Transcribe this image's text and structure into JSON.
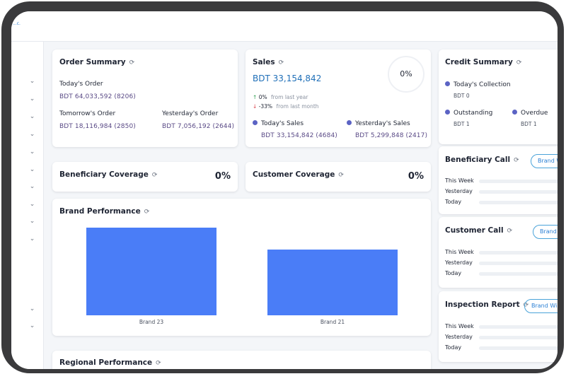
{
  "topbar": {
    "logo_text": "...c."
  },
  "order_summary": {
    "title": "Order Summary",
    "todays_order_label": "Today's Order",
    "todays_order_value": "BDT 64,033,592 (8206)",
    "tomorrows_order_label": "Tomorrow's Order",
    "tomorrows_order_value": "BDT 18,116,984 (2850)",
    "yesterdays_order_label": "Yesterday's Order",
    "yesterdays_order_value": "BDT 7,056,192 (2644)"
  },
  "sales": {
    "title": "Sales",
    "total": "BDT 33,154,842",
    "ring_percent": "0%",
    "last_year_change": "0%",
    "last_year_text": "from last year",
    "last_month_change": "-33%",
    "last_month_text": "from last month",
    "todays_sales_label": "Today's Sales",
    "todays_sales_value": "BDT 33,154,842 (4684)",
    "yesterdays_sales_label": "Yesterday's Sales",
    "yesterdays_sales_value": "BDT 5,299,848 (2417)"
  },
  "credit_summary": {
    "title": "Credit Summary",
    "todays_collection_label": "Today's Collection",
    "todays_collection_value": "BDT 0",
    "outstanding_label": "Outstanding",
    "outstanding_value": "BDT 1",
    "overdue_label": "Overdue",
    "overdue_value": "BDT 1"
  },
  "beneficiary_coverage": {
    "title": "Beneficiary Coverage",
    "value": "0%"
  },
  "customer_coverage": {
    "title": "Customer Coverage",
    "value": "0%"
  },
  "beneficiary_call": {
    "title": "Beneficiary Call",
    "filter_label": "Brand W",
    "rows": [
      "This Week",
      "Yesterday",
      "Today"
    ]
  },
  "customer_call": {
    "title": "Customer Call",
    "filter_label": "Brand",
    "rows": [
      "This Week",
      "Yesterday",
      "Today"
    ]
  },
  "inspection_report": {
    "title": "Inspection Report",
    "filter_label": "Brand Wi",
    "rows": [
      "This Week",
      "Yesterday",
      "Today"
    ]
  },
  "brand_performance": {
    "title": "Brand Performance"
  },
  "regional_performance": {
    "title": "Regional Performance"
  },
  "chart_data": {
    "type": "bar",
    "title": "Brand Performance",
    "categories": [
      "Brand 23",
      "Brand 21"
    ],
    "values": [
      100,
      75
    ],
    "ylim": [
      0,
      100
    ],
    "xlabel": "",
    "ylabel": "",
    "grid": false,
    "colors": [
      "#4a7df7"
    ]
  },
  "colors": {
    "accent": "#2a7fd4",
    "bar": "#4a7df7",
    "dot": "#5b63c4",
    "up": "#2e9e4f",
    "down": "#d9434b"
  },
  "icons": {
    "refresh": "refresh-icon",
    "chevron": "chevron-down-icon"
  }
}
